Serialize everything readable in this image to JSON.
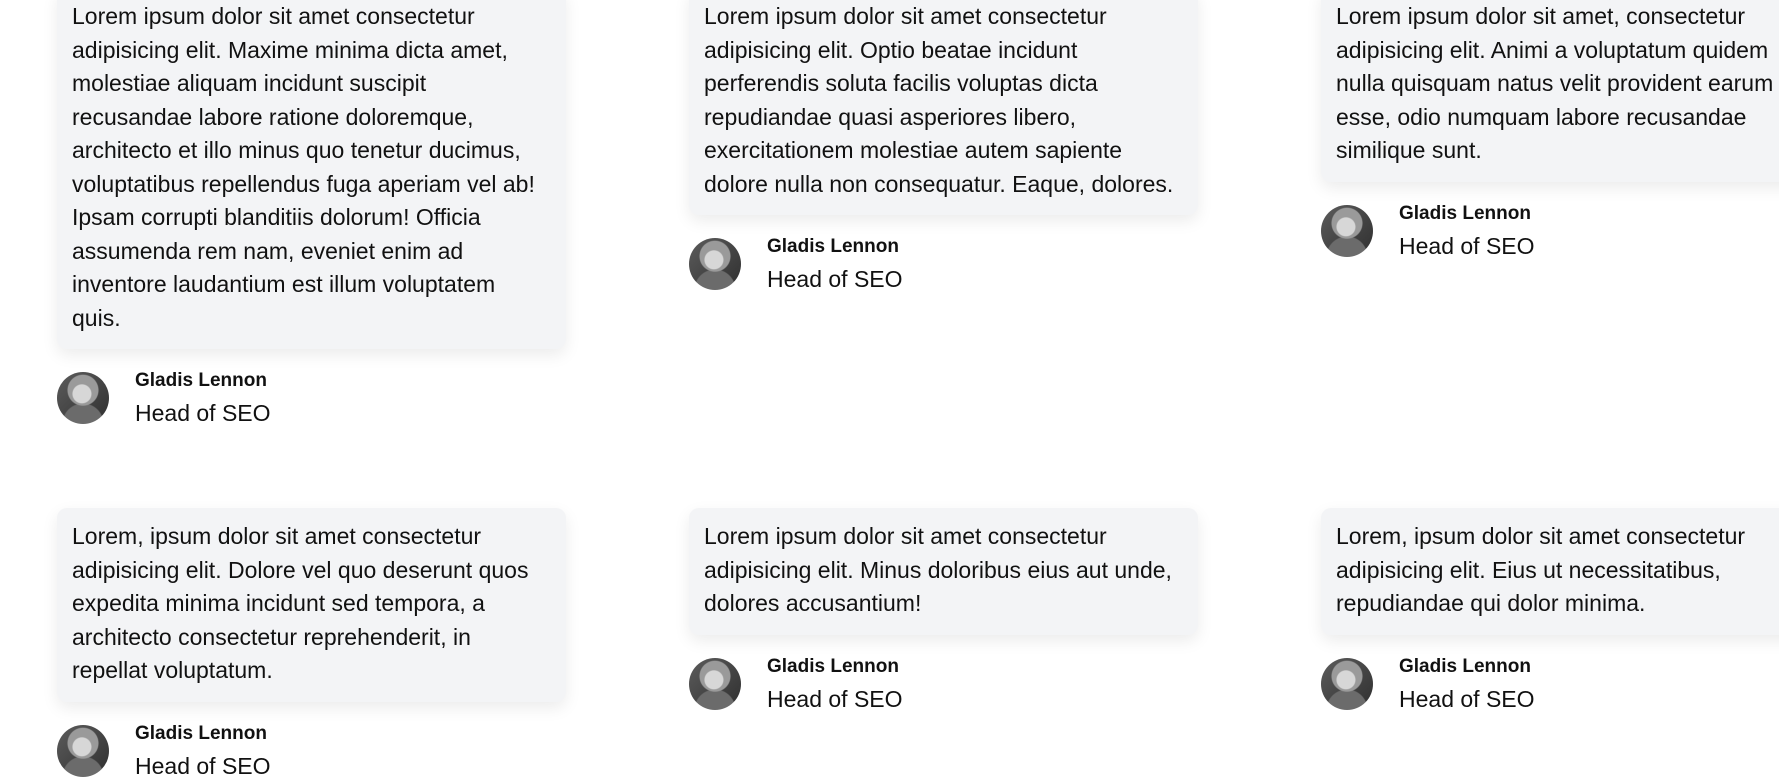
{
  "testimonials": [
    {
      "quote": "Lorem ipsum dolor sit amet consectetur adipisicing elit. Maxime minima dicta amet, molestiae aliquam incidunt suscipit recusandae labore ratione doloremque, architecto et illo minus quo tenetur ducimus, voluptatibus repellendus fuga aperiam vel ab! Ipsam corrupti blanditiis dolorum! Officia assumenda rem nam, eveniet enim ad inventore laudantium est illum voluptatem quis.",
      "name": "Gladis Lennon",
      "role": "Head of SEO",
      "avatar_icon": "avatar-photo"
    },
    {
      "quote": "Lorem ipsum dolor sit amet consectetur adipisicing elit. Optio beatae incidunt perferendis soluta facilis voluptas dicta repudiandae quasi asperiores libero, exercitationem molestiae autem sapiente dolore nulla non consequatur. Eaque, dolores.",
      "name": "Gladis Lennon",
      "role": "Head of SEO",
      "avatar_icon": "avatar-photo"
    },
    {
      "quote": "Lorem ipsum dolor sit amet, consectetur adipisicing elit. Animi a voluptatum quidem nulla quisquam natus velit provident earum esse, odio numquam labore recusandae similique sunt.",
      "name": "Gladis Lennon",
      "role": "Head of SEO",
      "avatar_icon": "avatar-photo"
    },
    {
      "quote": "Lorem, ipsum dolor sit amet consectetur adipisicing elit. Dolore vel quo deserunt quos expedita minima incidunt sed tempora, a architecto consectetur reprehenderit, in repellat voluptatum.",
      "name": "Gladis Lennon",
      "role": "Head of SEO",
      "avatar_icon": "avatar-photo"
    },
    {
      "quote": "Lorem ipsum dolor sit amet consectetur adipisicing elit. Minus doloribus eius aut unde, dolores accusantium!",
      "name": "Gladis Lennon",
      "role": "Head of SEO",
      "avatar_icon": "avatar-photo"
    },
    {
      "quote": "Lorem, ipsum dolor sit amet consectetur adipisicing elit. Eius ut necessitatibus, repudiandae qui dolor minima.",
      "name": "Gladis Lennon",
      "role": "Head of SEO",
      "avatar_icon": "avatar-photo"
    }
  ],
  "colors": {
    "card_background": "#f3f4f6",
    "text": "#111111",
    "page_background": "#ffffff"
  }
}
